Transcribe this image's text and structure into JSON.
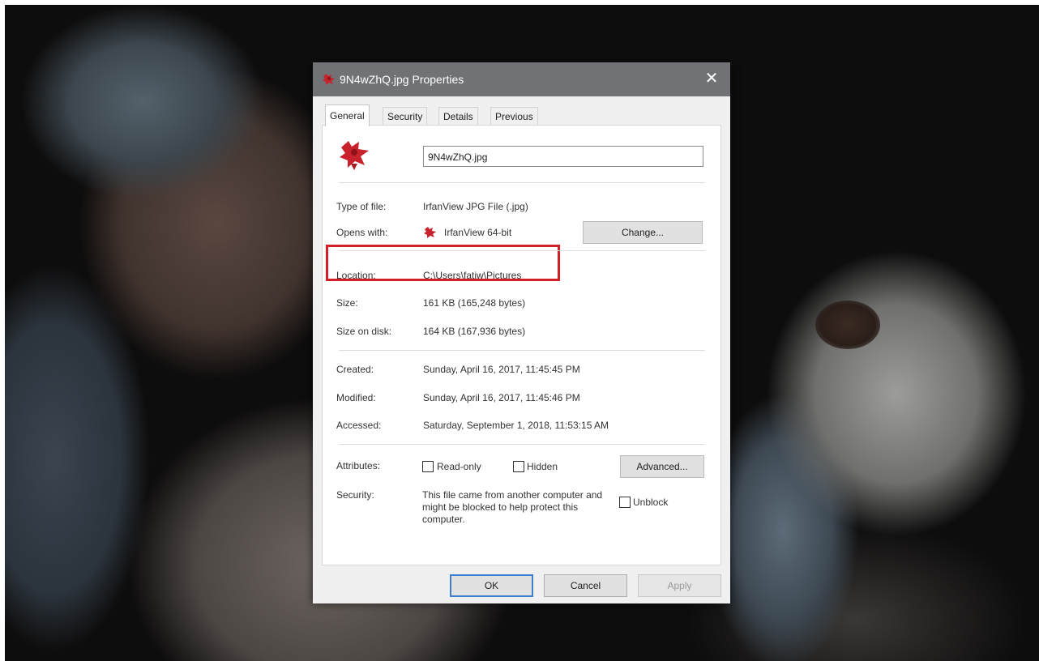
{
  "dialog": {
    "title": "9N4wZhQ.jpg Properties",
    "close_glyph": "✕",
    "tabs": [
      {
        "label": "General",
        "active": true
      },
      {
        "label": "Security",
        "active": false
      },
      {
        "label": "Details",
        "active": false
      },
      {
        "label": "Previous Versions",
        "active": false
      }
    ]
  },
  "general": {
    "file_name": "9N4wZhQ.jpg",
    "type_label": "Type of file:",
    "type_value": "IrfanView JPG File (.jpg)",
    "opens_label": "Opens with:",
    "opens_value": "IrfanView 64-bit",
    "change_button": "Change...",
    "location_label": "Location:",
    "location_value": "C:\\Users\\fatiw\\Pictures",
    "size_label": "Size:",
    "size_value": "161 KB (165,248 bytes)",
    "size_disk_label": "Size on disk:",
    "size_disk_value": "164 KB (167,936 bytes)",
    "created_label": "Created:",
    "created_value": "Sunday, April 16, 2017, 11:45:45 PM",
    "modified_label": "Modified:",
    "modified_value": "Sunday, April 16, 2017, 11:45:46 PM",
    "accessed_label": "Accessed:",
    "accessed_value": "Saturday, September 1, 2018, 11:53:15 AM",
    "attributes_label": "Attributes:",
    "readonly_label": "Read-only",
    "hidden_label": "Hidden",
    "advanced_button": "Advanced...",
    "security_label": "Security:",
    "security_text": "This file came from another computer and might be blocked to help protect this computer.",
    "unblock_label": "Unblock"
  },
  "footer": {
    "ok": "OK",
    "cancel": "Cancel",
    "apply": "Apply"
  },
  "colors": {
    "titlebar": "#707275",
    "highlight": "#d41f27",
    "icon_red": "#c8232c"
  },
  "icons": {
    "file_icon": "irfanview-icon",
    "close_icon": "close-icon"
  }
}
